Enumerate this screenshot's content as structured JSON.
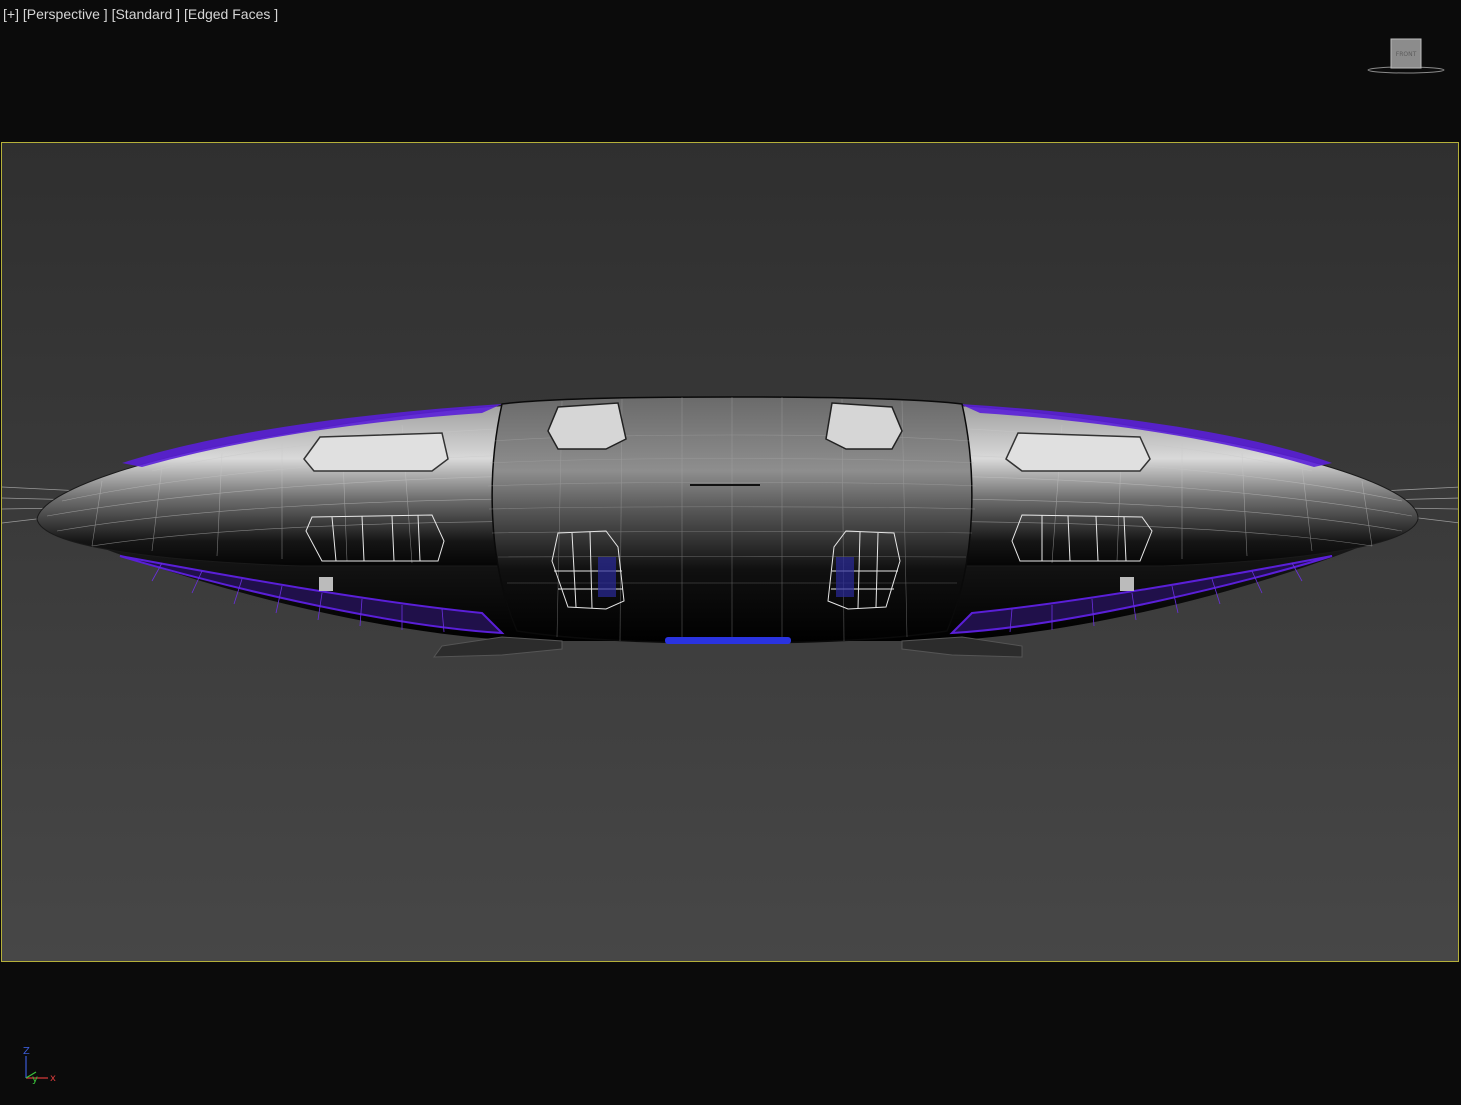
{
  "viewport": {
    "menu_plus": "[+]",
    "view_type": "[Perspective ]",
    "shading_mode": "[Standard ]",
    "display_mode": "[Edged Faces ]"
  },
  "viewcube": {
    "face_label": "FRONT"
  },
  "axis_tripod": {
    "z_label": "Z",
    "y_label": "y",
    "x_label": "x"
  },
  "colors": {
    "safe_frame_border": "#b5b03a",
    "hull_wire": "#cfcfcf",
    "accent_purple": "#5a1fd8",
    "light_blue": "#2a33e0",
    "axis_x": "#d43b3b",
    "axis_y": "#3bc43b",
    "axis_z": "#3b5bd4"
  }
}
